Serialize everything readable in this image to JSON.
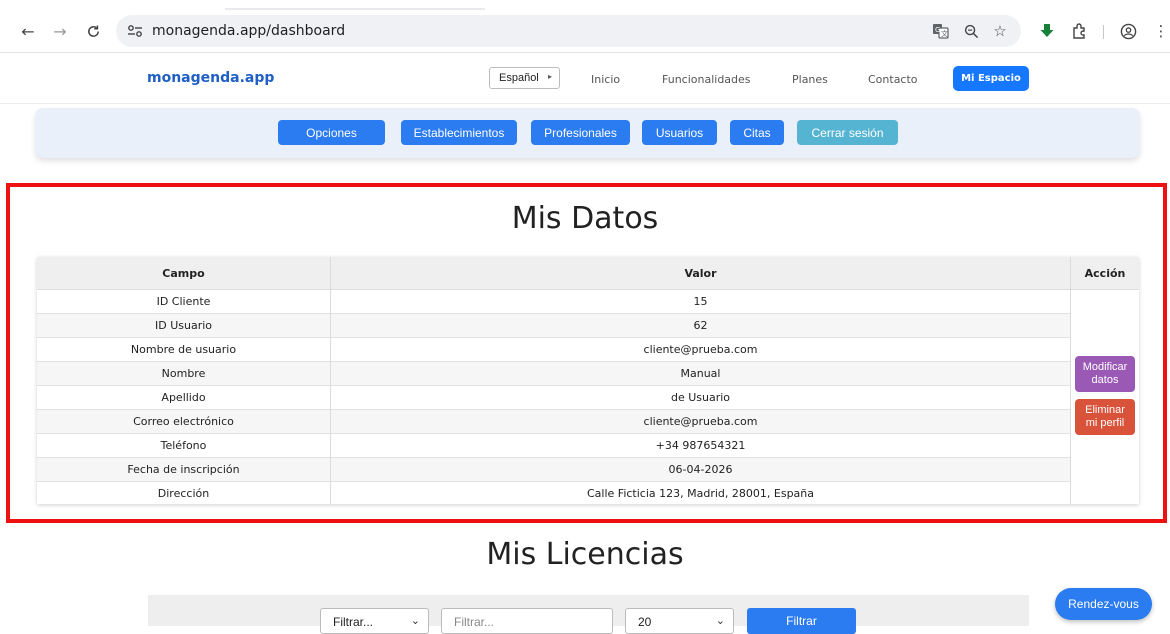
{
  "browser": {
    "url": "monagenda.app/dashboard",
    "icons": [
      "back-arrow-icon",
      "forward-arrow-icon",
      "reload-icon",
      "site-info-icon",
      "translate-icon",
      "zoom-icon",
      "bookmark-star-icon",
      "download-icon",
      "extensions-icon",
      "profile-icon",
      "menu-icon"
    ]
  },
  "navbar": {
    "brand": "monagenda.app",
    "language": "Español",
    "links": [
      "Inicio",
      "Funcionalidades",
      "Planes",
      "Contacto"
    ],
    "active": "Mi Espacio"
  },
  "actions": {
    "buttons": [
      "Opciones",
      "Establecimientos",
      "Profesionales",
      "Usuarios",
      "Citas",
      "Cerrar sesión"
    ]
  },
  "my_data": {
    "title": "Mis Datos",
    "columns": [
      "Campo",
      "Valor",
      "Acción"
    ],
    "rows": [
      {
        "field": "ID Cliente",
        "value": "15"
      },
      {
        "field": "ID Usuario",
        "value": "62"
      },
      {
        "field": "Nombre de usuario",
        "value": "cliente@prueba.com"
      },
      {
        "field": "Nombre",
        "value": "Manual"
      },
      {
        "field": "Apellido",
        "value": "de Usuario"
      },
      {
        "field": "Correo electrónico",
        "value": "cliente@prueba.com"
      },
      {
        "field": "Teléfono",
        "value": "+34 987654321"
      },
      {
        "field": "Fecha de inscripción",
        "value": "06-04-2026"
      },
      {
        "field": "Dirección",
        "value": "Calle Ficticia 123, Madrid, 28001, España"
      }
    ],
    "modify_line1": "Modificar",
    "modify_line2": "datos",
    "delete_line1": "Eliminar",
    "delete_line2": "mi perfil"
  },
  "licenses": {
    "title": "Mis Licencias",
    "filter_select": "Filtrar...",
    "filter_placeholder": "Filtrar...",
    "page_size": "20",
    "filter_button": "Filtrar"
  },
  "chat_button": "Rendez-vous",
  "colors": {
    "primary": "#2b7bf1",
    "teal": "#56b4d3",
    "modify": "#9b59b6",
    "delete": "#d9533b",
    "highlight": "#ee1111"
  }
}
